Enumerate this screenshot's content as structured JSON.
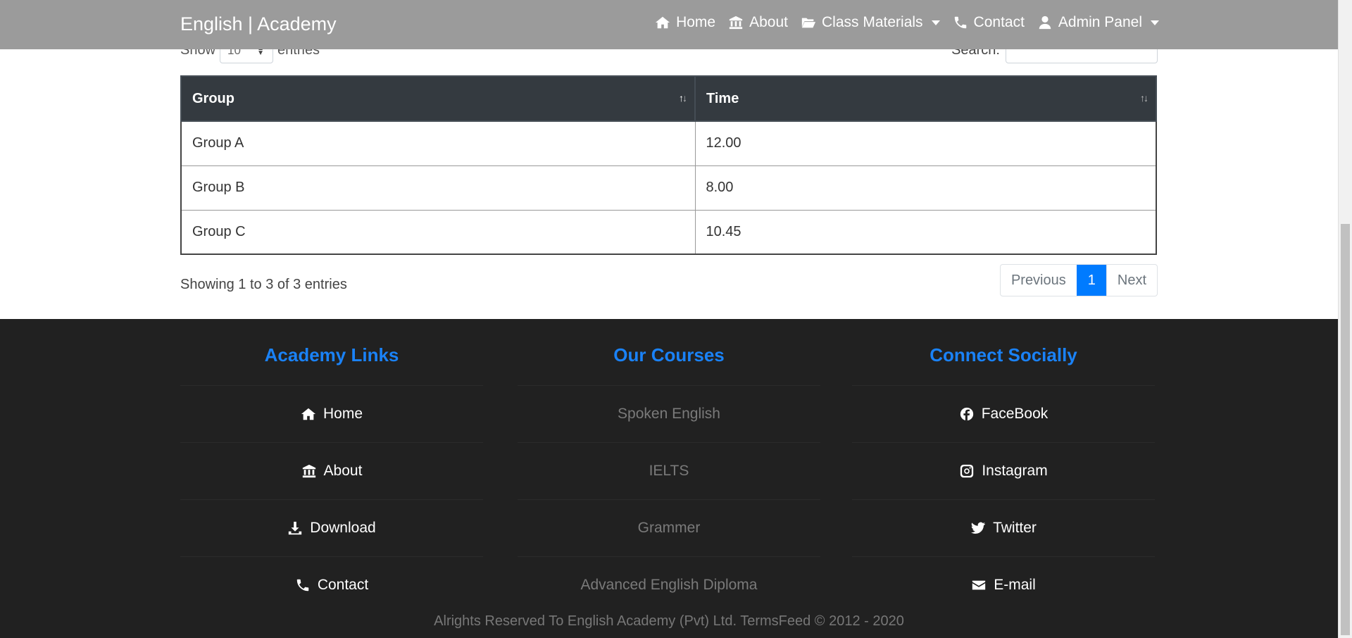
{
  "navbar": {
    "brand": "English | Academy",
    "links": [
      {
        "label": "Home",
        "icon": "home-icon"
      },
      {
        "label": "About",
        "icon": "bank-icon"
      },
      {
        "label": "Class Materials",
        "icon": "folder-open-icon",
        "dropdown": true
      },
      {
        "label": "Contact",
        "icon": "phone-icon"
      },
      {
        "label": "Admin Panel",
        "icon": "user-icon",
        "dropdown": true
      }
    ]
  },
  "table_controls": {
    "show_label": "Show",
    "entries_value": "10",
    "entries_label": "entries",
    "search_label": "Search:"
  },
  "table": {
    "headers": [
      "Group",
      "Time"
    ],
    "rows": [
      [
        "Group A",
        "12.00"
      ],
      [
        "Group B",
        "8.00"
      ],
      [
        "Group C",
        "10.45"
      ]
    ]
  },
  "info": "Showing 1 to 3 of 3 entries",
  "pagination": {
    "previous": "Previous",
    "current": "1",
    "next": "Next"
  },
  "footer": {
    "academy_links": {
      "title": "Academy Links",
      "items": [
        {
          "label": "Home",
          "icon": "home-icon"
        },
        {
          "label": "About",
          "icon": "bank-icon"
        },
        {
          "label": "Download",
          "icon": "download-icon"
        },
        {
          "label": "Contact",
          "icon": "phone-icon"
        }
      ]
    },
    "courses": {
      "title": "Our Courses",
      "items": [
        "Spoken English",
        "IELTS",
        "Grammer",
        "Advanced English Diploma"
      ]
    },
    "social": {
      "title": "Connect Socially",
      "items": [
        {
          "label": "FaceBook",
          "icon": "facebook-icon"
        },
        {
          "label": "Instagram",
          "icon": "instagram-icon"
        },
        {
          "label": "Twitter",
          "icon": "twitter-icon"
        },
        {
          "label": "E-mail",
          "icon": "envelope-icon"
        }
      ]
    },
    "copyright": "Alrights Reserved To English Academy (Pvt) Ltd.   TermsFeed © 2012 - 2020"
  },
  "colors": {
    "navbar": "#9b9b9b",
    "table_header": "#343a40",
    "accent": "#007bff",
    "footer": "#212121",
    "footer_title": "#1a82f7"
  }
}
